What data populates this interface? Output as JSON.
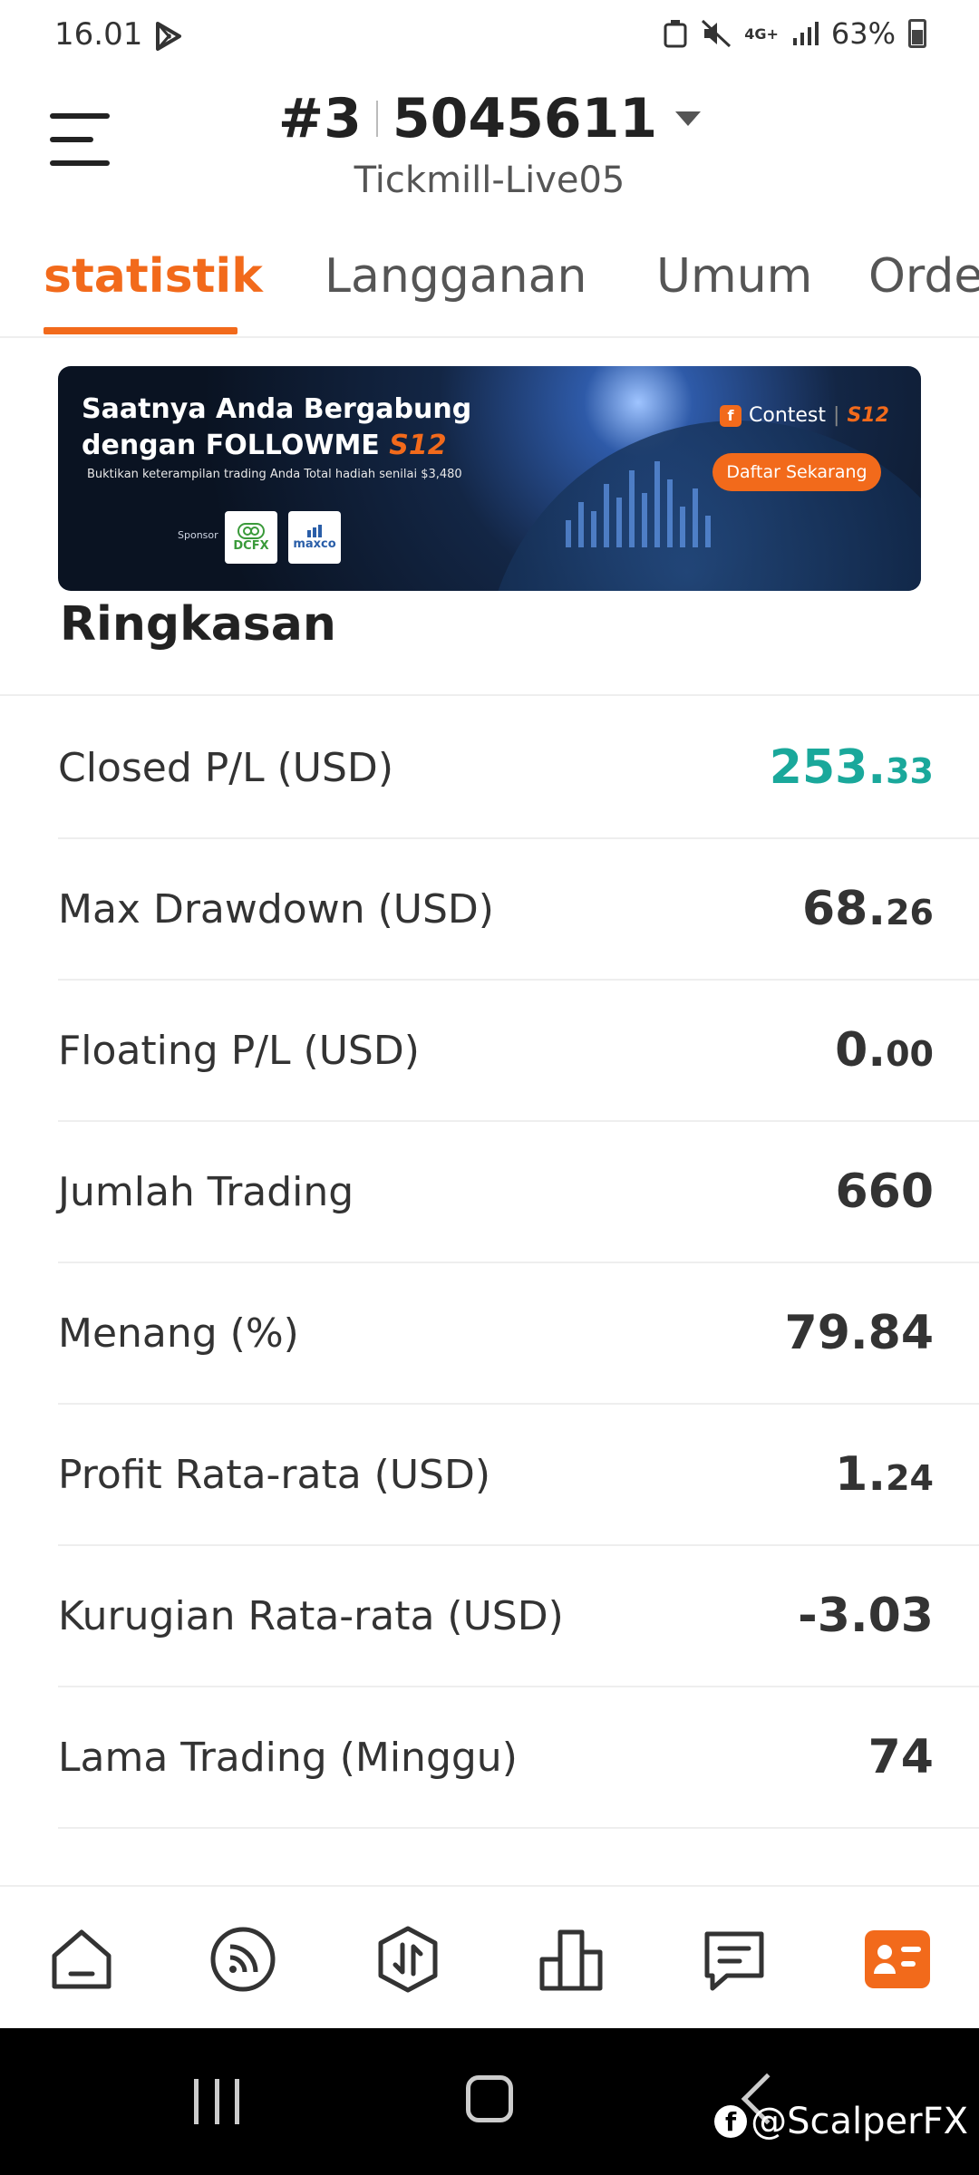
{
  "status_bar": {
    "time": "16.01",
    "network": "4G+",
    "battery": "63%"
  },
  "header": {
    "account_prefix": "#3",
    "account_number": "5045611",
    "server": "Tickmill-Live05"
  },
  "tabs": [
    {
      "label": "statistik",
      "active": true
    },
    {
      "label": "Langganan",
      "active": false
    },
    {
      "label": "Umum",
      "active": false
    },
    {
      "label": "Order",
      "active": false
    }
  ],
  "banner": {
    "title_line1": "Saatnya Anda Bergabung",
    "title_line2": "dengan FOLLOWME",
    "title_badge": "S12",
    "subtitle": "Buktikan keterampilan trading Anda Total hadiah senilai $3,480",
    "sponsor_label": "Sponsor",
    "sponsors": [
      "DCFX",
      "maxco"
    ],
    "contest_label": "Contest",
    "contest_badge": "S12",
    "cta": "Daftar Sekarang"
  },
  "section": {
    "title": "Ringkasan"
  },
  "stats": [
    {
      "label": "Closed P/L (USD)",
      "main": "253.",
      "decimal": "33",
      "color": "#1aa89b"
    },
    {
      "label": "Max Drawdown (USD)",
      "main": "68.",
      "decimal": "26"
    },
    {
      "label": "Floating P/L (USD)",
      "main": "0.",
      "decimal": "00"
    },
    {
      "label": "Jumlah Trading",
      "main": "660",
      "decimal": ""
    },
    {
      "label": "Menang (%)",
      "main": "79.84",
      "decimal": ""
    },
    {
      "label": "Profit Rata-rata (USD)",
      "main": "1.",
      "decimal": "24"
    },
    {
      "label": "Kurugian Rata-rata (USD)",
      "main": "-3.03",
      "decimal": ""
    },
    {
      "label": "Lama Trading (Minggu)",
      "main": "74",
      "decimal": ""
    }
  ],
  "bottom_nav": [
    {
      "icon": "home-icon",
      "active": false
    },
    {
      "icon": "feed-icon",
      "active": false
    },
    {
      "icon": "trade-icon",
      "active": false
    },
    {
      "icon": "ranking-icon",
      "active": false
    },
    {
      "icon": "message-icon",
      "active": false
    },
    {
      "icon": "profile-card-icon",
      "active": true
    }
  ],
  "colors": {
    "accent": "#f26a1b",
    "positive": "#1aa89b"
  },
  "watermark": "@ScalperFX"
}
